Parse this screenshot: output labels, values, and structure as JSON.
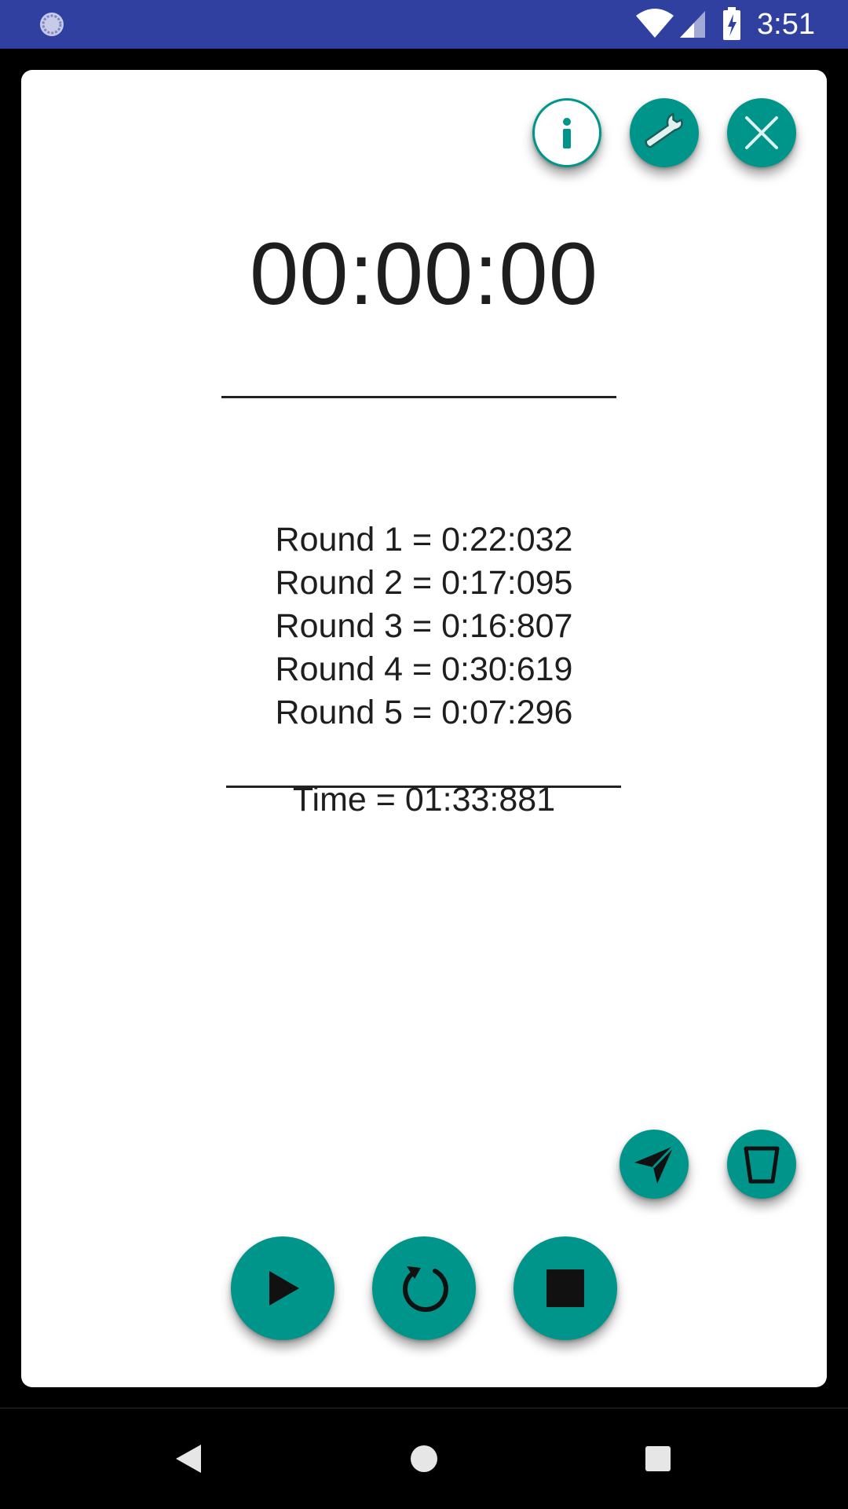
{
  "status_bar": {
    "time": "3:51",
    "icons": [
      "sync-spinner-icon",
      "wifi-icon",
      "cell-signal-icon",
      "battery-charging-icon"
    ],
    "background": "#3040a0"
  },
  "dialog": {
    "top_actions": [
      {
        "name": "info-button",
        "icon": "info-icon"
      },
      {
        "name": "settings-button",
        "icon": "wrench-icon"
      },
      {
        "name": "close-button",
        "icon": "close-icon"
      }
    ],
    "timer_display": "00:00:00",
    "rounds": [
      "Round 1 = 0:22:032",
      "Round 2 = 0:17:095",
      "Round 3 = 0:16:807",
      "Round 4 = 0:30:619",
      "Round 5 = 0:07:296"
    ],
    "total_time": "Time = 01:33:881",
    "secondary_actions": [
      {
        "name": "send-button",
        "icon": "send-icon"
      },
      {
        "name": "delete-button",
        "icon": "trash-icon"
      }
    ],
    "controls": [
      {
        "name": "play-button",
        "icon": "play-icon"
      },
      {
        "name": "reset-button",
        "icon": "refresh-icon"
      },
      {
        "name": "stop-button",
        "icon": "stop-icon"
      }
    ],
    "accent_color": "#00958a"
  },
  "nav_bar": {
    "buttons": [
      "back-icon",
      "home-icon",
      "recents-icon"
    ]
  }
}
